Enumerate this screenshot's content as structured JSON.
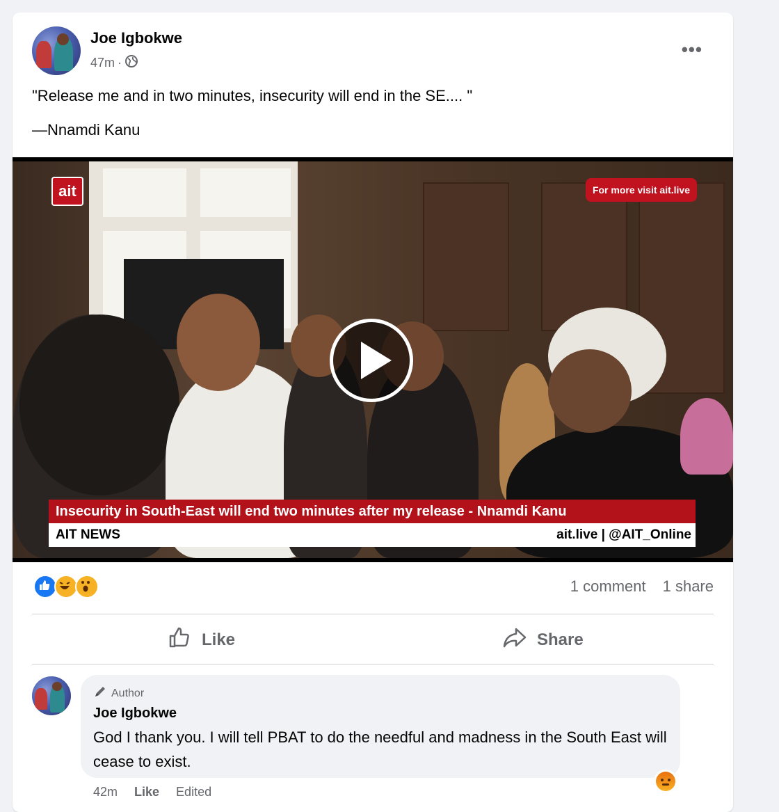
{
  "post": {
    "author": "Joe Igbokwe",
    "time": "47m",
    "privacy_icon": "globe-icon",
    "quote": "\"Release me and in two minutes, insecurity will end in the SE.... \"",
    "attribution": "—Nnamdi Kanu",
    "more_icon": "more-options-icon"
  },
  "video": {
    "logo": "ait",
    "visit_text": "For more visit ait.live",
    "headline": "Insecurity in South-East will end two minutes after my release - Nnamdi Kanu",
    "channel": "AIT NEWS",
    "handle": "ait.live | @AIT_Online"
  },
  "engagement": {
    "reactions": [
      "like",
      "haha",
      "wow"
    ],
    "comments": "1 comment",
    "shares": "1 share"
  },
  "actions": {
    "like_label": "Like",
    "share_label": "Share"
  },
  "comment": {
    "badge": "Author",
    "author": "Joe Igbokwe",
    "text": "God I thank you. I will tell PBAT to do the needful and madness in the South East will cease to exist.",
    "time": "42m",
    "like_label": "Like",
    "edited": "Edited",
    "reaction": "angry"
  },
  "colors": {
    "page_bg": "#f0f2f5",
    "card_bg": "#ffffff",
    "secondary_text": "#65676b",
    "ait_red": "#c1121f",
    "fb_blue": "#1877f2"
  }
}
